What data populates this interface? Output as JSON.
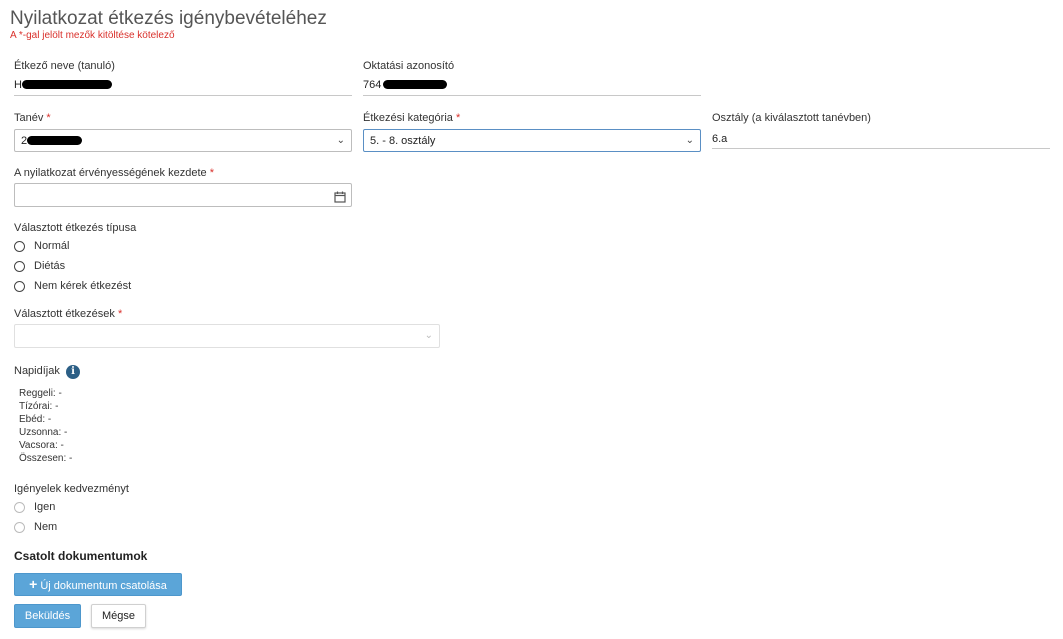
{
  "header": {
    "title": "Nyilatkozat étkezés igénybevételéhez",
    "required_note": "A *-gal jelölt mezők kitöltése kötelező"
  },
  "fields": {
    "student_name": {
      "label": "Étkező neve (tanuló)",
      "value_prefix": "H"
    },
    "education_id": {
      "label": "Oktatási azonosító",
      "value_prefix": "764"
    },
    "school_year": {
      "label": "Tanév",
      "required": "*",
      "value_prefix": "2"
    },
    "category": {
      "label": "Étkezési kategória",
      "required": "*",
      "value": "5. - 8. osztály"
    },
    "class": {
      "label": "Osztály (a kiválasztott tanévben)",
      "value": "6.a"
    },
    "valid_from": {
      "label": "A nyilatkozat érvényességének kezdete",
      "required": "*",
      "value": ""
    },
    "meal_type": {
      "label": "Választott étkezés típusa",
      "options": [
        "Normál",
        "Diétás",
        "Nem kérek étkezést"
      ]
    },
    "selected_meals": {
      "label": "Választott étkezések",
      "required": "*",
      "value": ""
    }
  },
  "daily_fees": {
    "label": "Napidíjak",
    "info_symbol": "i",
    "items": [
      "Reggeli: -",
      "Tízórai: -",
      "Ebéd: -",
      "Uzsonna: -",
      "Vacsora: -",
      "Összesen: -"
    ]
  },
  "discount": {
    "label": "Igényelek kedvezményt",
    "options": [
      "Igen",
      "Nem"
    ]
  },
  "documents": {
    "heading": "Csatolt dokumentumok",
    "add_icon": "+",
    "add_label": "Új dokumentum csatolása"
  },
  "actions": {
    "submit_label": "Beküldés",
    "cancel_label": "Mégse"
  },
  "colors": {
    "required": "#d9302b",
    "primary_button": "#5ba5d8",
    "info_icon": "#2c5f86"
  },
  "icons": {
    "calendar": "calendar-icon",
    "dropdown": "chevron-down-icon",
    "info": "info-icon",
    "plus": "plus-icon"
  }
}
